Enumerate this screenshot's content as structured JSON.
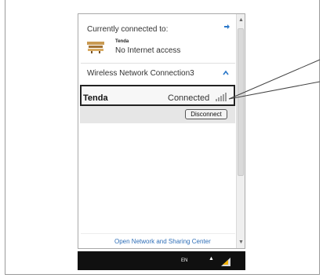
{
  "header": {
    "connected_to": "Currently connected to:"
  },
  "network": {
    "name": "Tenda",
    "status": "No Internet access"
  },
  "section": {
    "title": "Wireless Network Connection3"
  },
  "wifi": {
    "ssid": "Tenda",
    "state": "Connected"
  },
  "actions": {
    "disconnect": "Disconnect"
  },
  "footer": {
    "open_center": "Open Network and Sharing Center"
  },
  "taskbar": {
    "language": "EN"
  },
  "icons": {
    "refresh": "refresh-icon",
    "network": "network-icon",
    "collapse": "chevron-up-icon",
    "signal": "wifi-signal-icon",
    "tray": "network-tray-icon"
  },
  "colors": {
    "accent": "#2b78c9",
    "link": "#2f6fb8",
    "taskbar": "#101010"
  }
}
